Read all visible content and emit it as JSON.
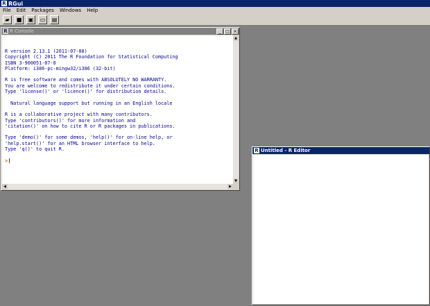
{
  "app": {
    "title": "RGui"
  },
  "menu": [
    "File",
    "Edit",
    "Packages",
    "Windows",
    "Help"
  ],
  "toolbar": [
    "open-script",
    "save",
    "load-workspace",
    "copy",
    "print"
  ],
  "console": {
    "title": "R Console",
    "lines": [
      "R version 2.13.1 (2011-07-08)",
      "Copyright (C) 2011 The R Foundation for Statistical Computing",
      "ISBN 3-900051-07-0",
      "Platform: i386-pc-mingw32/i386 (32-bit)",
      "",
      "R is free software and comes with ABSOLUTELY NO WARRANTY.",
      "You are welcome to redistribute it under certain conditions.",
      "Type 'license()' or 'licence()' for distribution details.",
      "",
      "  Natural language support but running in an English locale",
      "",
      "R is a collaborative project with many contributors.",
      "Type 'contributors()' for more information and",
      "'citation()' on how to cite R or R packages in publications.",
      "",
      "Type 'demo()' for some demos, 'help()' for on-line help, or",
      "'help.start()' for an HTML browser interface to help.",
      "Type 'q()' to quit R."
    ],
    "prompt": ">"
  },
  "editor": {
    "title": "Untitled - R Editor"
  }
}
